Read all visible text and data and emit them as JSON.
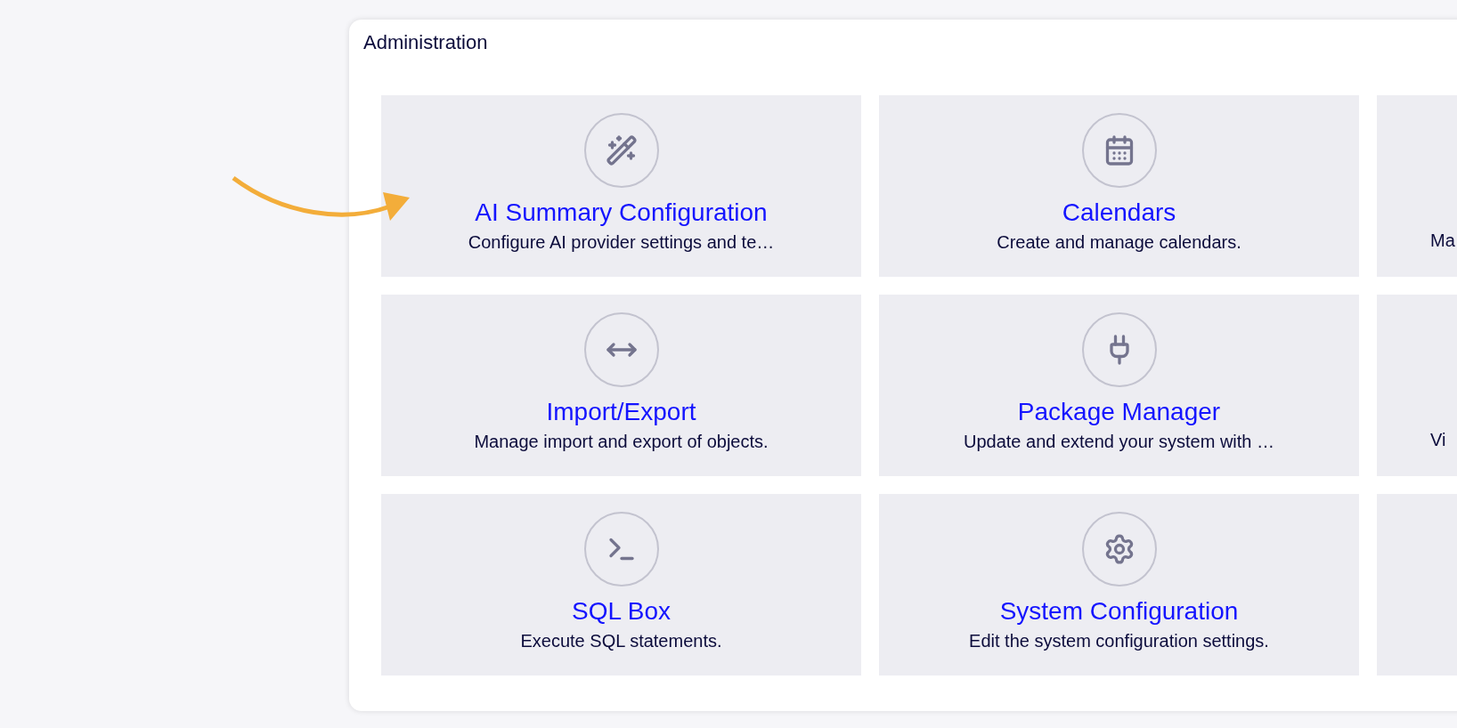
{
  "panel": {
    "title": "Administration"
  },
  "cards": [
    {
      "kind": "full",
      "title": "AI Summary Configuration",
      "description": "Configure AI provider settings and te…"
    },
    {
      "kind": "full",
      "title": "Calendars",
      "description": "Create and manage calendars."
    },
    {
      "kind": "cut",
      "description": "Ma"
    },
    {
      "kind": "full",
      "title": "Import/Export",
      "description": "Manage import and export of objects."
    },
    {
      "kind": "full",
      "title": "Package Manager",
      "description": "Update and extend your system with …"
    },
    {
      "kind": "cut",
      "description": "Vi"
    },
    {
      "kind": "full",
      "title": "SQL Box",
      "description": "Execute SQL statements."
    },
    {
      "kind": "full",
      "title": "System Configuration",
      "description": "Edit the system configuration settings."
    },
    {
      "kind": "cut"
    }
  ]
}
